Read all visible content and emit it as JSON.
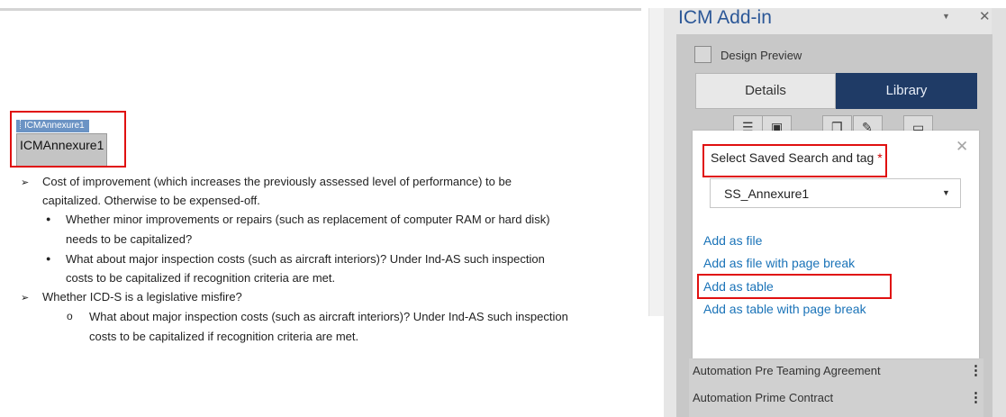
{
  "document": {
    "content_control": {
      "tag_label": "ICMAnnexure1",
      "text": "ICMAnnexure1"
    },
    "lines": [
      {
        "bullet": "➢",
        "text": "Cost of improvement (which increases the previously assessed level of performance) to be"
      },
      {
        "bullet": "",
        "text": "capitalized. Otherwise to be expensed-off."
      },
      {
        "bullet": "●",
        "text": "Whether minor improvements or repairs (such as replacement of computer RAM or hard disk)"
      },
      {
        "bullet": "",
        "text": "needs to be capitalized?"
      },
      {
        "bullet": "●",
        "text": "What about major inspection costs (such as aircraft interiors)? Under Ind-AS such inspection"
      },
      {
        "bullet": "",
        "text": "costs to be capitalized if recognition criteria are met."
      },
      {
        "bullet": "➢",
        "text": "Whether ICD-S is a legislative misfire?"
      },
      {
        "bullet": "o",
        "text": "What about major inspection costs (such as aircraft interiors)? Under Ind-AS such inspection"
      },
      {
        "bullet": "",
        "text": "costs to be capitalized if recognition criteria are met."
      }
    ]
  },
  "pane": {
    "title": "ICM Add-in",
    "dropdown_glyph": "▼",
    "close_glyph": "✕",
    "design_preview_label": "Design Preview",
    "design_preview_checked": false,
    "tabs": [
      {
        "label": "Details",
        "active": false
      },
      {
        "label": "Library",
        "active": true
      }
    ],
    "toolbar_icons": [
      "list-icon",
      "clipboard-icon",
      "copy-icon",
      "edit-icon",
      "frame-icon"
    ],
    "list_items": [
      {
        "label": "Automation Pre Teaming Agreement",
        "menu": "⋮"
      },
      {
        "label": "Automation Prime Contract",
        "menu": "⋮"
      }
    ]
  },
  "dialog": {
    "close_glyph": "✕",
    "select_label": "Select Saved Search and tag",
    "required_mark": "*",
    "selected_value": "SS_Annexure1",
    "select_arrow": "▼",
    "links": [
      "Add as file",
      "Add as file with page break",
      "Add as table",
      "Add as table with page break"
    ]
  },
  "colors": {
    "accent": "#1f3b66",
    "link": "#1a73b8",
    "highlight": "#e01010",
    "title": "#2b5797"
  }
}
